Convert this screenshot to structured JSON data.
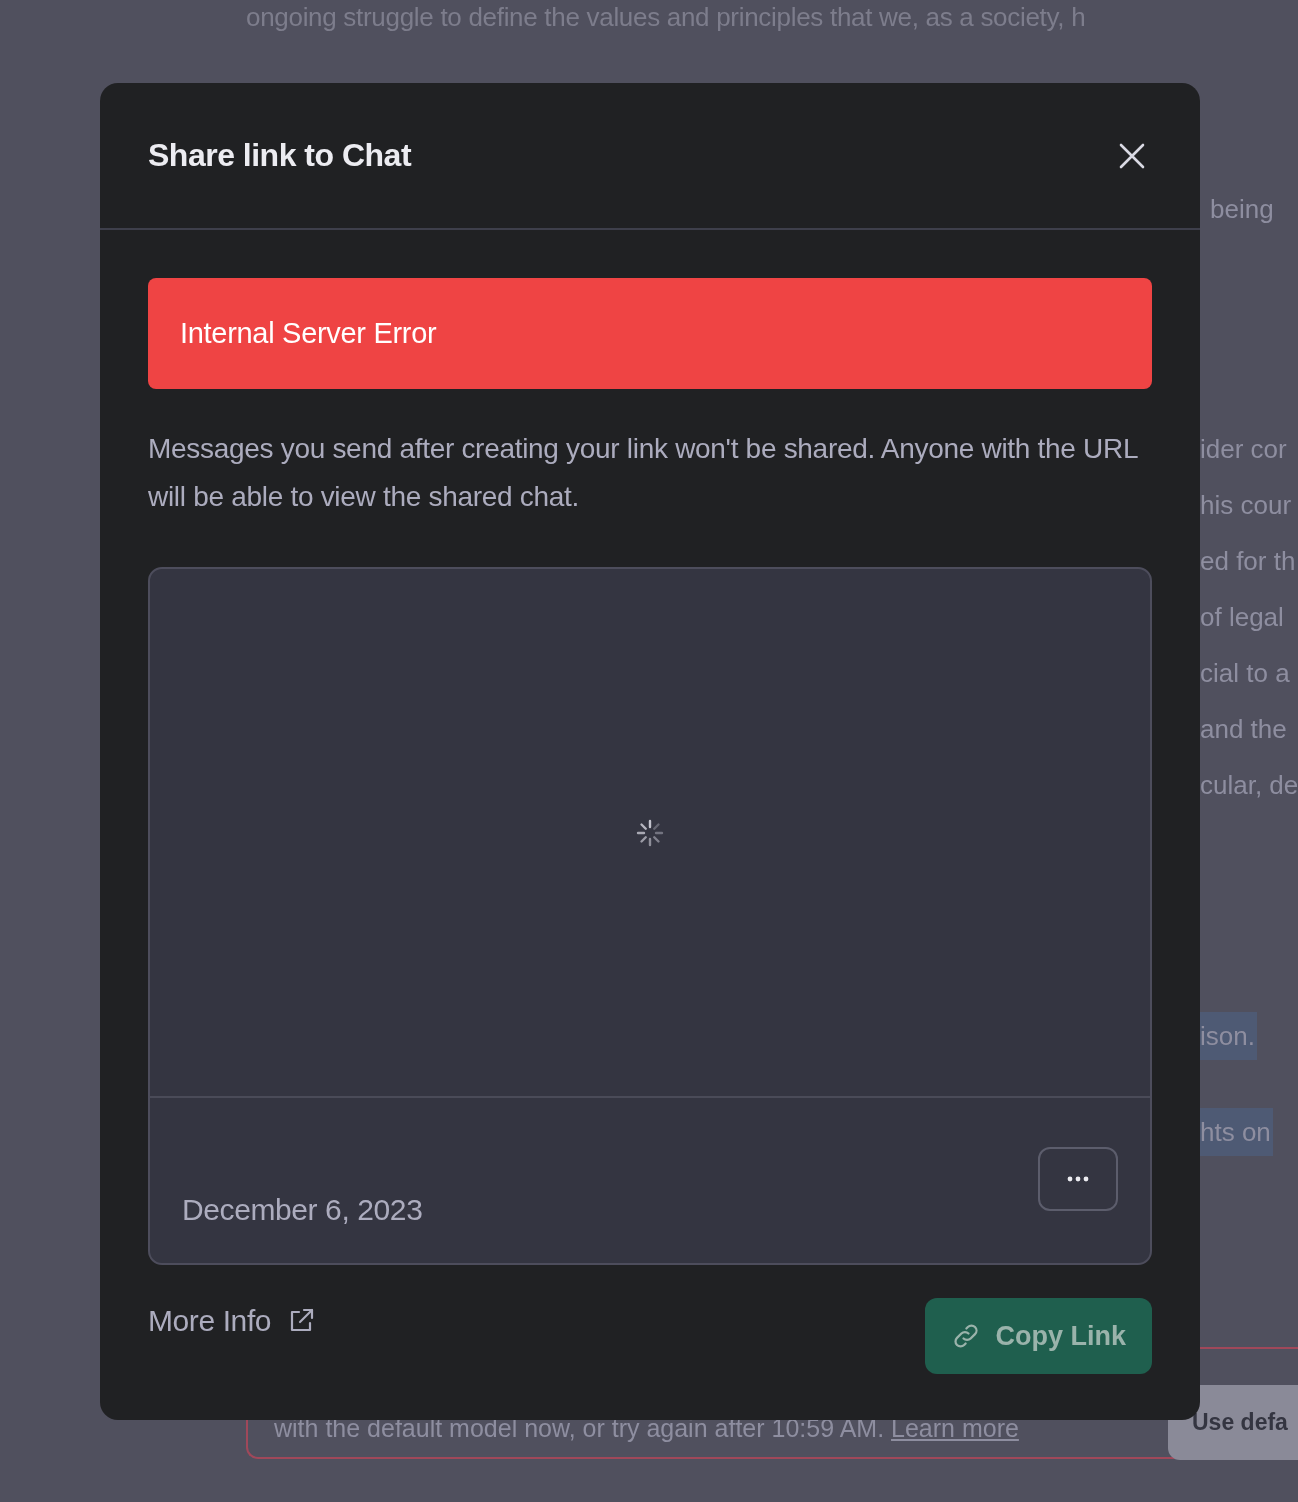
{
  "background": {
    "top_line": "ongoing struggle to define the values and principles that we, as a society, h",
    "fragments": [
      {
        "text": "being",
        "highlighted": false
      },
      {
        "text": "ider cor",
        "highlighted": false
      },
      {
        "text": "his cour",
        "highlighted": false
      },
      {
        "text": "ed for th",
        "highlighted": false
      },
      {
        "text": "of legal",
        "highlighted": false
      },
      {
        "text": "cial to a",
        "highlighted": false
      },
      {
        "text": "and the",
        "highlighted": false
      },
      {
        "text": "cular, de",
        "highlighted": false
      },
      {
        "text": "ison.",
        "highlighted": true
      },
      {
        "text": "hts on",
        "highlighted": true
      }
    ],
    "notice": {
      "text": "with the default model now, or try again after 10:59 AM.",
      "link": "Learn more",
      "button": "Use defa"
    }
  },
  "dialog": {
    "title": "Share link to Chat",
    "error": "Internal Server Error",
    "description": "Messages you send after creating your link won't be shared. Anyone with the URL will be able to view the shared chat.",
    "preview": {
      "loading": true,
      "date": "December 6, 2023"
    },
    "more_info": "More Info",
    "copy_button": {
      "label": "Copy Link",
      "disabled": true
    }
  }
}
